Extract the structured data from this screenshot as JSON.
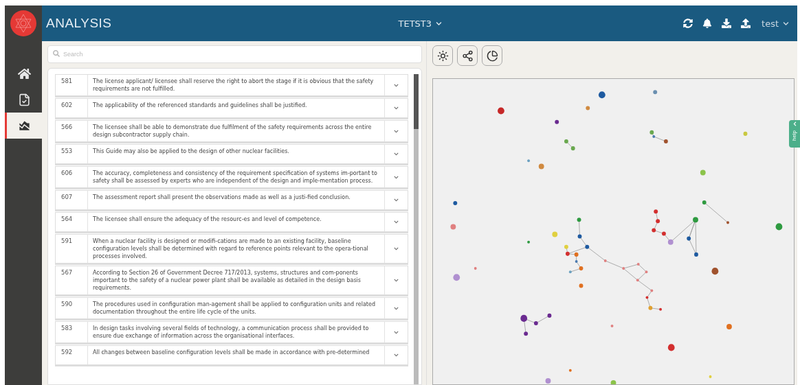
{
  "header": {
    "title": "ANALYSIS",
    "project": "TETST3",
    "user": "test"
  },
  "sidebar": {
    "items": [
      {
        "kind": "home",
        "selected": false
      },
      {
        "kind": "checklist",
        "selected": false
      },
      {
        "kind": "chart",
        "selected": true
      }
    ]
  },
  "search": {
    "placeholder": "Search"
  },
  "requirements": [
    {
      "id": "581",
      "text": "The license applicant/ licensee shall reserve the right to abort the stage if it is obvious that the safety requirements are not fulfilled."
    },
    {
      "id": "602",
      "text": "The applicability of the referenced standards and guidelines shall be justified."
    },
    {
      "id": "566",
      "text": "The licensee shall be able to demonstrate due fulfilment of the safety requirements across the entire design subcontractor supply chain."
    },
    {
      "id": "553",
      "text": "This Guide may also be applied to the design of other nuclear facilities."
    },
    {
      "id": "606",
      "text": "The accuracy, completeness and consistency of the requirement specification of systems im-portant to safety shall be assessed by experts who are independent of the design and imple-mentation process."
    },
    {
      "id": "607",
      "text": "The assessment report shall present the observations made as well as a justi-fied conclusion."
    },
    {
      "id": "564",
      "text": "The licensee shall ensure the adequacy of the resourc-es and level of competence."
    },
    {
      "id": "591",
      "text": "When a nuclear facility is designed or modifi-cations are made to an existing facility, baseline configuration levels shall be determined with regard to reference points relevant to the opera-tional processes involved."
    },
    {
      "id": "567",
      "text": "According to Section 26 of Government Decree 717/2013, systems, structures and com-ponents important to the safety of a nuclear power plant shall be available as detailed in the design basis requirements."
    },
    {
      "id": "590",
      "text": "The procedures used in configuration man-agement shall be applied to configuration units and related documentation throughout the entire life cycle of the units."
    },
    {
      "id": "583",
      "text": "In design tasks involving several fields of technology, a communication process shall be provided to ensure due exchange of information across the organisational interfaces."
    },
    {
      "id": "592",
      "text": "All changes between baseline configuration levels shall be made in accordance with pre-determined"
    }
  ],
  "help_tab": {
    "label": "help"
  }
}
